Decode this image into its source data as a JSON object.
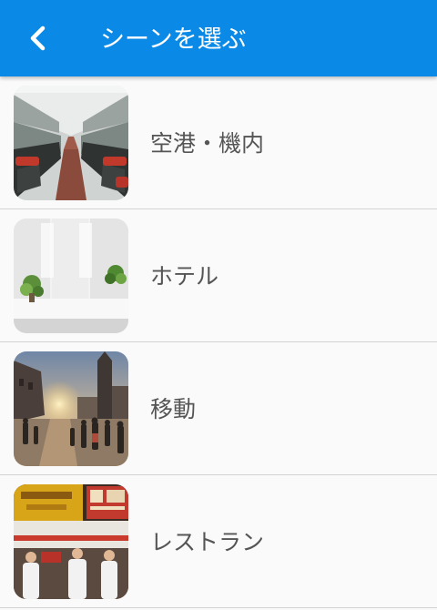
{
  "header": {
    "title": "シーンを選ぶ",
    "back_icon": "chevron-left-icon"
  },
  "scenes": [
    {
      "label": "空港・機内",
      "image": "airplane-cabin-photo"
    },
    {
      "label": "ホテル",
      "image": "hotel-lobby-photo"
    },
    {
      "label": "移動",
      "image": "city-street-photo"
    },
    {
      "label": "レストラン",
      "image": "restaurant-photo"
    }
  ],
  "colors": {
    "app_bar": "#0a8ae6",
    "list_background": "#fafafa",
    "divider": "#d3d3d3",
    "label_text": "#555555"
  }
}
